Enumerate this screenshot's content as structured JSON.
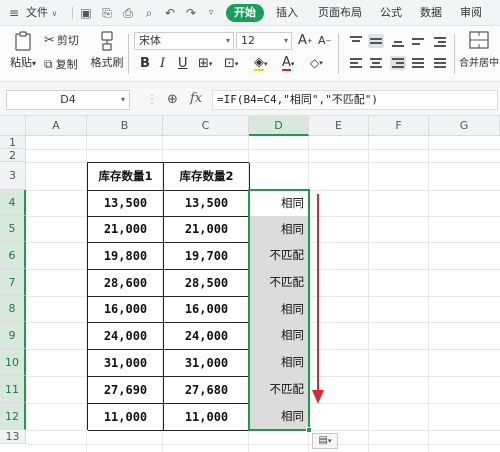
{
  "menubar": {
    "file_label": "文件",
    "tabs": [
      "开始",
      "插入",
      "页面布局",
      "公式",
      "数据",
      "审阅"
    ],
    "active_tab": "开始"
  },
  "ribbon": {
    "paste_label": "粘贴",
    "cut_label": "剪切",
    "copy_label": "复制",
    "format_painter_label": "格式刷",
    "font_name": "宋体",
    "font_size": "12",
    "merge_label": "合并居中"
  },
  "formula_bar": {
    "cell_ref": "D4",
    "formula": "=IF(B4=C4,\"相同\",\"不匹配\")"
  },
  "sheet": {
    "columns": [
      "A",
      "B",
      "C",
      "D",
      "E",
      "F",
      "G"
    ],
    "rows": [
      "1",
      "2",
      "3",
      "4",
      "5",
      "6",
      "7",
      "8",
      "9",
      "10",
      "11",
      "12",
      "13"
    ],
    "selected_column": "D",
    "headers": [
      "库存数量1",
      "库存数量2"
    ],
    "data": [
      {
        "b": "13,500",
        "c": "13,500",
        "d": "相同"
      },
      {
        "b": "21,000",
        "c": "21,000",
        "d": "相同"
      },
      {
        "b": "19,800",
        "c": "19,700",
        "d": "不匹配"
      },
      {
        "b": "28,600",
        "c": "28,500",
        "d": "不匹配"
      },
      {
        "b": "16,000",
        "c": "16,000",
        "d": "相同"
      },
      {
        "b": "24,000",
        "c": "24,000",
        "d": "相同"
      },
      {
        "b": "31,000",
        "c": "31,000",
        "d": "相同"
      },
      {
        "b": "27,690",
        "c": "27,680",
        "d": "不匹配"
      },
      {
        "b": "11,000",
        "c": "11,000",
        "d": "相同"
      }
    ],
    "arrow_color": "#d9282f",
    "selection_color": "#1f9a4c"
  }
}
